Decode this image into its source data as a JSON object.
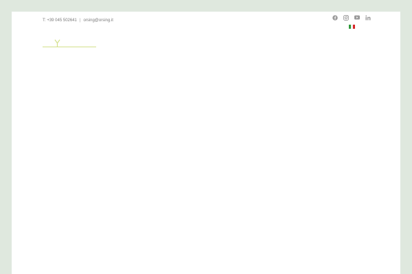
{
  "header": {
    "phone": "T: +39 045 502641",
    "separator": "|",
    "email": "orsing@orsing.it"
  },
  "social": [
    {
      "icon": "facebook-icon"
    },
    {
      "icon": "instagram-icon"
    },
    {
      "icon": "youtube-icon"
    },
    {
      "icon": "linkedin-icon"
    }
  ],
  "language": {
    "flag_icon": "italy-flag-icon",
    "colors": [
      "#2f9a3a",
      "#ffffff",
      "#d62828"
    ]
  },
  "colors": {
    "background": "#dfe8de",
    "icon": "#9a9a9a",
    "logo": "#d3e08a"
  }
}
